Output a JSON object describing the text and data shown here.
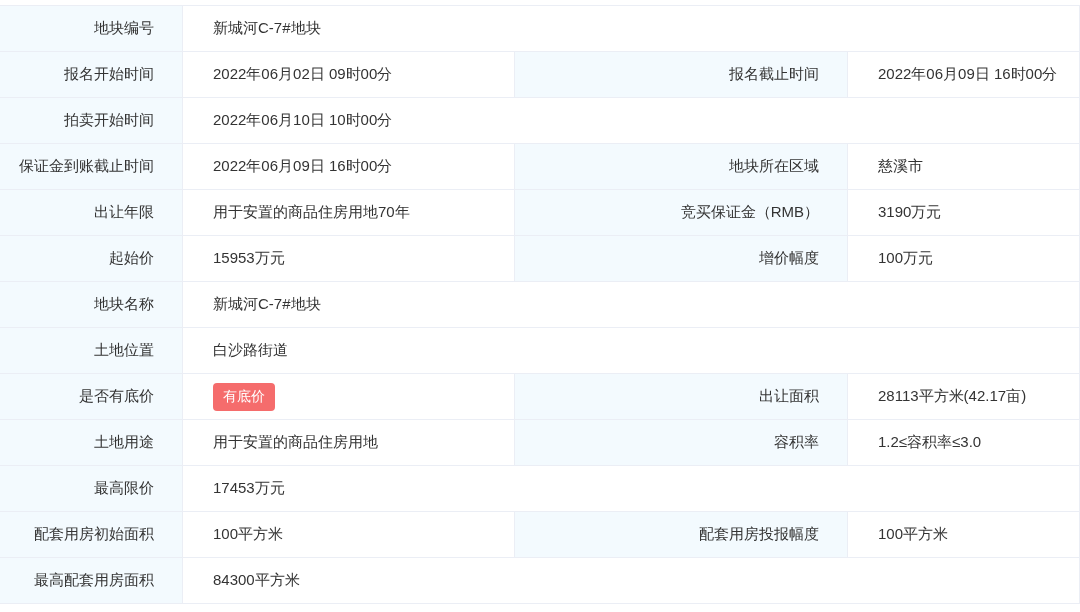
{
  "rows": [
    {
      "fields": [
        {
          "label": "地块编号",
          "value": "新城河C-7#地块"
        }
      ]
    },
    {
      "fields": [
        {
          "label": "报名开始时间",
          "value": "2022年06月02日 09时00分"
        },
        {
          "label": "报名截止时间",
          "value": "2022年06月09日 16时00分"
        }
      ]
    },
    {
      "fields": [
        {
          "label": "拍卖开始时间",
          "value": "2022年06月10日 10时00分"
        }
      ]
    },
    {
      "fields": [
        {
          "label": "保证金到账截止时间",
          "value": "2022年06月09日 16时00分"
        },
        {
          "label": "地块所在区域",
          "value": "慈溪市"
        }
      ]
    },
    {
      "fields": [
        {
          "label": "出让年限",
          "value": "用于安置的商品住房用地70年"
        },
        {
          "label": "竞买保证金（RMB）",
          "value": "3190万元"
        }
      ]
    },
    {
      "fields": [
        {
          "label": "起始价",
          "value": "15953万元"
        },
        {
          "label": "增价幅度",
          "value": "100万元"
        }
      ]
    },
    {
      "fields": [
        {
          "label": "地块名称",
          "value": "新城河C-7#地块"
        }
      ]
    },
    {
      "fields": [
        {
          "label": "土地位置",
          "value": "白沙路街道"
        }
      ]
    },
    {
      "fields": [
        {
          "label": "是否有底价",
          "value": "有底价",
          "kind": "tag"
        },
        {
          "label": "出让面积",
          "value": "28113平方米(42.17亩)"
        }
      ]
    },
    {
      "fields": [
        {
          "label": "土地用途",
          "value": "用于安置的商品住房用地"
        },
        {
          "label": "容积率",
          "value": "1.2≤容积率≤3.0"
        }
      ]
    },
    {
      "fields": [
        {
          "label": "最高限价",
          "value": "17453万元"
        }
      ]
    },
    {
      "fields": [
        {
          "label": "配套用房初始面积",
          "value": "100平方米"
        },
        {
          "label": "配套用房投报幅度",
          "value": "100平方米"
        }
      ]
    },
    {
      "fields": [
        {
          "label": "最高配套用房面积",
          "value": "84300平方米"
        }
      ]
    }
  ]
}
